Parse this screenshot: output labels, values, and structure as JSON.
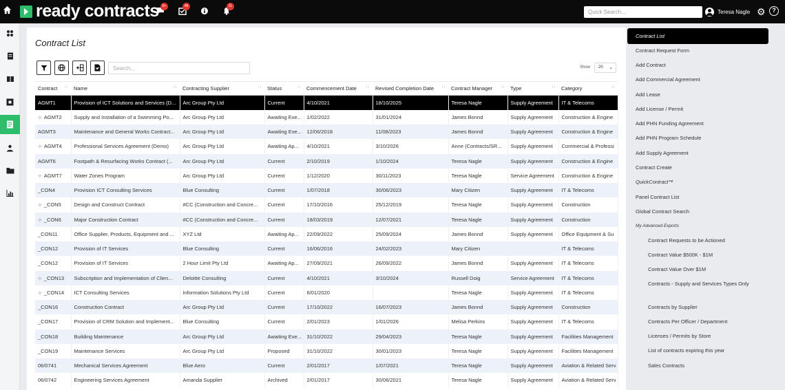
{
  "topbar": {
    "logo_text": "ready contracts",
    "badges": {
      "messages": "9+",
      "tasks": "48",
      "alerts": "11"
    },
    "search_placeholder": "Quick Search...",
    "user_name": "Teresa Nagle"
  },
  "main": {
    "title": "Contract List",
    "search_placeholder": "Search...",
    "show_label": "Show",
    "page_size": "20"
  },
  "table": {
    "columns": [
      "Contract",
      "Name",
      "Contracting Supplier",
      "Status",
      "Commencement Date",
      "Revised Completion Date",
      "Contract Manager",
      "Type",
      "Category"
    ],
    "rows": [
      {
        "tree": false,
        "contract": "AGMT1",
        "name": "Provision of ICT Solutions and Services (D...",
        "supplier": "Arc Group Pty Ltd",
        "status": "Current",
        "start": "4/10/2021",
        "end": "18/10/2025",
        "manager": "Teresa Nagle",
        "type": "Supply Agreement",
        "category": "IT & Telecoms"
      },
      {
        "tree": true,
        "contract": "AGMT2",
        "name": "Supply and Installation of a Swimming Po...",
        "supplier": "Arc Group Pty Ltd",
        "status": "Awaiting Exe...",
        "start": "1/02/2022",
        "end": "31/01/2024",
        "manager": "James Bonnd",
        "type": "Supply Agreement",
        "category": "Construction & Engine"
      },
      {
        "tree": false,
        "contract": "AGMT3",
        "name": "Maintenance and General Works Contract...",
        "supplier": "Arc Group Pty Ltd",
        "status": "Awaiting Exe...",
        "start": "12/06/2018",
        "end": "11/08/2023",
        "manager": "James Bonnd",
        "type": "Supply Agreement",
        "category": "Construction & Engine"
      },
      {
        "tree": true,
        "contract": "AGMT4",
        "name": "Professional Services Agreement (Demo)",
        "supplier": "Arc Group Pty Ltd",
        "status": "Awaiting Ap...",
        "start": "4/10/2021",
        "end": "3/10/2026",
        "manager": "Anne (Contracts/SR...",
        "type": "Supply Agreement",
        "category": "Commercial & Professi"
      },
      {
        "tree": false,
        "contract": "AGMT6",
        "name": "Footpath & Resurfacing Works Contract (...",
        "supplier": "Arc Group Pty Ltd",
        "status": "Current",
        "start": "2/10/2019",
        "end": "1/10/2024",
        "manager": "Teresa Nagle",
        "type": "Supply Agreement",
        "category": "Construction & Engine"
      },
      {
        "tree": true,
        "contract": "AGMT7",
        "name": "Water Zones Program",
        "supplier": "Arc Group Pty Ltd",
        "status": "Current",
        "start": "1/12/2020",
        "end": "30/11/2023",
        "manager": "Teresa Nagle",
        "type": "Service Agreement",
        "category": "Construction & Engine"
      },
      {
        "tree": false,
        "contract": "_CON4",
        "name": "Provision ICT Consulting Services",
        "supplier": "Blue Consulting",
        "status": "Current",
        "start": "1/07/2018",
        "end": "30/06/2023",
        "manager": "Mary Citizen",
        "type": "Supply Agreement",
        "category": "IT & Telecoms"
      },
      {
        "tree": true,
        "contract": "_CON5",
        "name": "Design and Construct Contract",
        "supplier": "#CC (Construction and Concre...",
        "status": "Current",
        "start": "17/10/2016",
        "end": "25/12/2019",
        "manager": "Teresa Nagle",
        "type": "Supply Agreement",
        "category": "Construction"
      },
      {
        "tree": true,
        "contract": "_CON6",
        "name": "Major Construction Contract",
        "supplier": "#CC (Construction and Concre...",
        "status": "Current",
        "start": "18/03/2019",
        "end": "12/07/2021",
        "manager": "Teresa Nagle",
        "type": "Supply Agreement",
        "category": "Construction"
      },
      {
        "tree": false,
        "contract": "_CON11",
        "name": "Office Supplier, Products, Equipment and ...",
        "supplier": "XYZ Ltd",
        "status": "Awaiting Ap...",
        "start": "22/09/2022",
        "end": "25/09/2024",
        "manager": "James Bonnd",
        "type": "Supply Agreement",
        "category": "Office Equipment & Su"
      },
      {
        "tree": false,
        "contract": "_CON12",
        "name": "Provision of IT Services",
        "supplier": "Blue Consulting",
        "status": "Current",
        "start": "16/06/2016",
        "end": "24/02/2023",
        "manager": "Mary Citizen",
        "type": "",
        "category": "IT & Telecoms"
      },
      {
        "tree": false,
        "contract": "_CON12",
        "name": "Provision of IT Services",
        "supplier": "2 Hour Limit Pty Ltd",
        "status": "Awaiting Ap...",
        "start": "27/09/2021",
        "end": "26/09/2022",
        "manager": "James Bonnd",
        "type": "Supply Agreement",
        "category": "IT & Telecoms"
      },
      {
        "tree": true,
        "contract": "_CON13",
        "name": "Subscription and Implementation of Clien...",
        "supplier": "Deloitte Consulting",
        "status": "Current",
        "start": "4/10/2021",
        "end": "3/10/2024",
        "manager": "Russell Doig",
        "type": "Service Agreement",
        "category": "IT & Telecoms"
      },
      {
        "tree": true,
        "contract": "_CON14",
        "name": "ICT Consulting Services",
        "supplier": "Information Solutions Pty Ltd",
        "status": "Current",
        "start": "6/01/2020",
        "end": "",
        "manager": "Teresa Nagle",
        "type": "Supply Agreement",
        "category": "IT & Telecoms"
      },
      {
        "tree": false,
        "contract": "_CON16",
        "name": "Construction Contract",
        "supplier": "Arc Group Pty Ltd",
        "status": "Current",
        "start": "17/10/2022",
        "end": "16/07/2023",
        "manager": "James Bonnd",
        "type": "Supply Agreement",
        "category": "Construction"
      },
      {
        "tree": false,
        "contract": "_CON17",
        "name": "Provision of CRM Solution and Implement...",
        "supplier": "Blue Consulting",
        "status": "Current",
        "start": "2/01/2023",
        "end": "1/01/2026",
        "manager": "Melisa Perkins",
        "type": "Supply Agreement",
        "category": "IT & Telecoms"
      },
      {
        "tree": false,
        "contract": "_CON18",
        "name": "Building Maintenance",
        "supplier": "Arc Group Pty Ltd",
        "status": "Awaiting Exe...",
        "start": "31/10/2022",
        "end": "29/04/2023",
        "manager": "Teresa Nagle",
        "type": "Supply Agreement",
        "category": "Facilities Management"
      },
      {
        "tree": false,
        "contract": "_CON19",
        "name": "Maintenance Services",
        "supplier": "Arc Group Pty Ltd",
        "status": "Proposed",
        "start": "31/10/2022",
        "end": "30/01/2023",
        "manager": "Teresa Nagle",
        "type": "Supply Agreement",
        "category": "Facilities Management"
      },
      {
        "tree": false,
        "contract": "06/0741",
        "name": "Mechanical Services Agreement",
        "supplier": "Blue Aero",
        "status": "Current",
        "start": "2/01/2017",
        "end": "1/07/2021",
        "manager": "Teresa Nagle",
        "type": "Supply Agreement",
        "category": "Aviation & Related Serv"
      },
      {
        "tree": false,
        "contract": "06/0742",
        "name": "Engineering Services Agreement",
        "supplier": "Amanda Supplier",
        "status": "Archived",
        "start": "2/01/2017",
        "end": "30/06/2021",
        "manager": "Teresa Nagle",
        "type": "Supply Agreement",
        "category": "Aviation & Related Serv"
      }
    ]
  },
  "sidebar": {
    "items": [
      "Contract List",
      "Contract Request Form",
      "Add Contract",
      "Add Commercial Agreement",
      "Add Lease",
      "Add License / Permit",
      "Add PHN Funding Agreement",
      "Add PHN Program Schedule",
      "Add Supply Agreement",
      "Contract Create",
      "QuickContract™",
      "Panel Contract List",
      "Global Contract Search"
    ],
    "exports_heading": "My Advanced Exports",
    "exports": [
      "Contract Requests to be Actioned",
      "Contract Value $500K - $1M",
      "Contract Value Over $1M",
      "Contracts - Supply and Services Types Only",
      "Contracts by Supplier",
      "Contracts Per Officer / Department",
      "Licenses / Permits by Store",
      "List of contracts expiring this year",
      "Sales Contracts"
    ]
  }
}
